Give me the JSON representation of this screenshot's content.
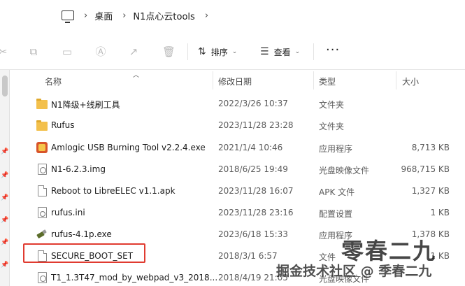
{
  "breadcrumb": {
    "items": [
      "桌面",
      "N1点心云tools"
    ]
  },
  "toolbar": {
    "sort_label": "排序",
    "view_label": "查看",
    "more_label": "···",
    "icons": [
      "cut-icon",
      "copy-icon",
      "paste-icon",
      "rename-icon",
      "share-icon",
      "delete-icon"
    ]
  },
  "columns": {
    "name": "名称",
    "date": "修改日期",
    "type": "类型",
    "size": "大小"
  },
  "files": [
    {
      "name": "N1降级+线刷工具",
      "date": "2022/3/26 10:37",
      "type": "文件夹",
      "size": "",
      "icon": "folder-icon"
    },
    {
      "name": "Rufus",
      "date": "2023/11/28 23:28",
      "type": "文件夹",
      "size": "",
      "icon": "folder-icon"
    },
    {
      "name": "Amlogic USB Burning Tool v2.2.4.exe",
      "date": "2021/1/4 10:46",
      "type": "应用程序",
      "size": "8,713 KB",
      "icon": "app-icon"
    },
    {
      "name": "N1-6.2.3.img",
      "date": "2018/6/25 19:49",
      "type": "光盘映像文件",
      "size": "968,715 KB",
      "icon": "disc-image-icon"
    },
    {
      "name": "Reboot to LibreELEC v1.1.apk",
      "date": "2023/11/28 16:07",
      "type": "APK 文件",
      "size": "1,327 KB",
      "icon": "file-icon"
    },
    {
      "name": "rufus.ini",
      "date": "2023/11/28 23:16",
      "type": "配置设置",
      "size": "1 KB",
      "icon": "settings-file-icon"
    },
    {
      "name": "rufus-4.1p.exe",
      "date": "2023/6/18 15:33",
      "type": "应用程序",
      "size": "1,378 KB",
      "icon": "usb-app-icon"
    },
    {
      "name": "SECURE_BOOT_SET",
      "date": "2018/3/1 6:57",
      "type": "文件",
      "size": "1 KB",
      "icon": "file-icon"
    },
    {
      "name": "T1_1.3T47_mod_by_webpad_v3_2018...",
      "date": "2018/4/19 21:05",
      "type": "光盘映像文件",
      "size": "",
      "icon": "disc-image-icon"
    }
  ],
  "watermark": {
    "big": "零春二九",
    "small": "掘金技术社区 @ 季春二九"
  }
}
